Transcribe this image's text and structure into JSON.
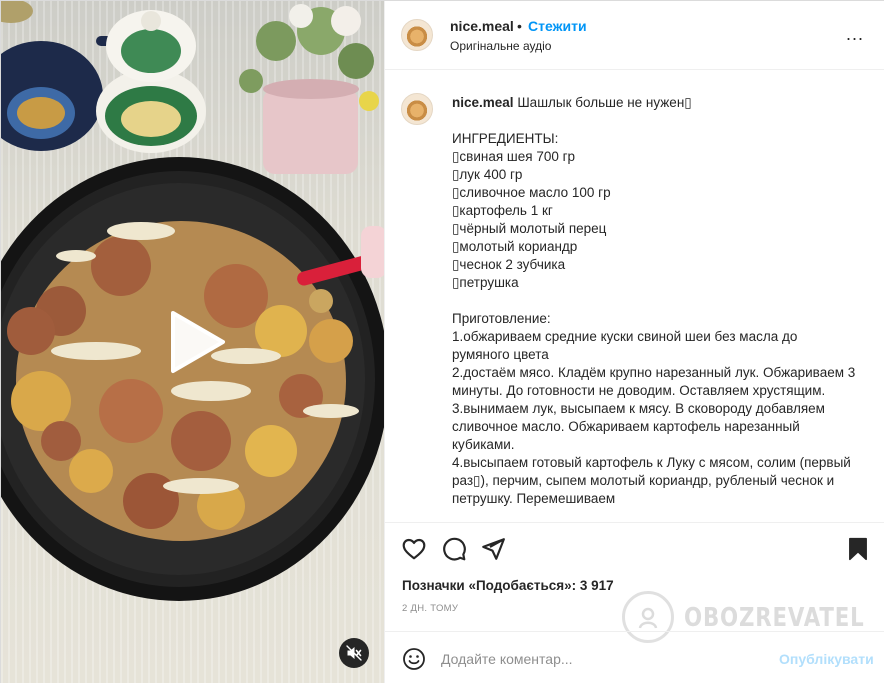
{
  "header": {
    "username": "nice.meal",
    "separator": "•",
    "follow_label": "Стежити",
    "audio_label": "Оригінальне аудіо",
    "more_label": "..."
  },
  "caption": {
    "username": "nice.meal",
    "title": "Шашлык больше не нужен▯",
    "ingredients_heading": "ИНГРЕДИЕНТЫ:",
    "ingredients": [
      "▯свиная шея 700 гр",
      "▯лук 400 гр",
      "▯сливочное масло 100 гр",
      "▯картофель 1 кг",
      "▯чёрный молотый перец",
      "▯молотый кориандр",
      "▯чеснок 2 зубчика",
      "▯петрушка"
    ],
    "steps_heading": "Приготовление:",
    "steps": [
      "1.обжариваем средние куски свиной шеи без масла до румяного цвета",
      "2.достаём мясо. Кладём крупно нарезанный лук. Обжариваем 3 минуты. До готовности не доводим. Оставляем хрустящим.",
      "3.вынимаем лук, высыпаем к мясу. В сковороду добавляем сливочное масло. Обжариваем картофель нарезанный кубиками.",
      "4.высыпаем готовый картофель к Луку с мясом, солим (первый раз▯), перчим, сыпем молотый кориандр, рубленый чеснок и петрушку. Перемешиваем"
    ]
  },
  "actions": {
    "like_icon": "heart-icon",
    "comment_icon": "comment-icon",
    "share_icon": "paper-plane-icon",
    "save_icon": "bookmark-icon"
  },
  "likes_text": "Позначки «Подобається»: 3 917",
  "date_text": "2 дн. тому",
  "comment": {
    "emoji_icon": "smiley-icon",
    "placeholder": "Додайте коментар...",
    "publish_label": "Опублікувати"
  },
  "watermark": {
    "text": "OBOZREVATEL"
  },
  "colors": {
    "accent": "#0095f6",
    "publish_disabled": "#b2dffc",
    "text": "#262626",
    "muted": "#8e8e8e",
    "divider": "#efefef"
  }
}
